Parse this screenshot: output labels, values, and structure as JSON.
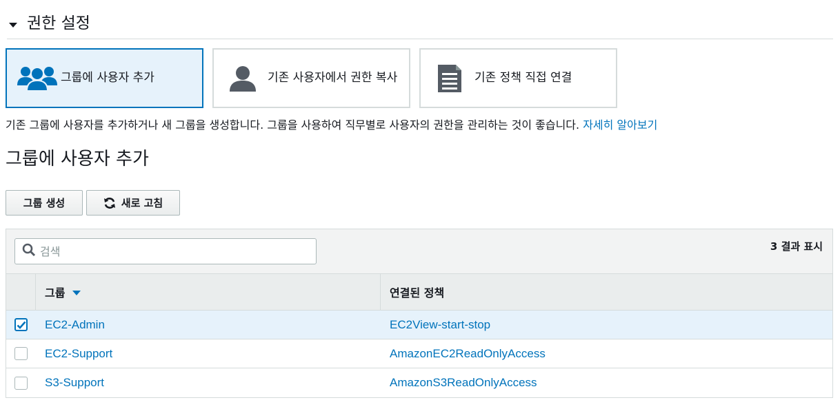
{
  "section": {
    "title": "권한 설정"
  },
  "options": [
    {
      "label": "그룹에 사용자 추가",
      "selected": true,
      "icon": "users-group-icon"
    },
    {
      "label": "기존 사용자에서 권한 복사",
      "selected": false,
      "icon": "user-icon"
    },
    {
      "label": "기존 정책 직접 연결",
      "selected": false,
      "icon": "document-icon"
    }
  ],
  "description": {
    "text": "기존 그룹에 사용자를 추가하거나 새 그룹을 생성합니다. 그룹을 사용하여 직무별로 사용자의 권한을 관리하는 것이 좋습니다. ",
    "link": "자세히 알아보기"
  },
  "subsection": {
    "title": "그룹에 사용자 추가"
  },
  "toolbar": {
    "create_label": "그룹 생성",
    "refresh_label": "새로 고침"
  },
  "table": {
    "search_placeholder": "검색",
    "result_count": "3 결과 표시",
    "columns": {
      "group": "그룹",
      "policy": "연결된 정책"
    },
    "rows": [
      {
        "group": "EC2-Admin",
        "policy": "EC2View-start-stop",
        "checked": true
      },
      {
        "group": "EC2-Support",
        "policy": "AmazonEC2ReadOnlyAccess",
        "checked": false
      },
      {
        "group": "S3-Support",
        "policy": "AmazonS3ReadOnlyAccess",
        "checked": false
      }
    ]
  },
  "colors": {
    "accent": "#0073bb",
    "selected_bg": "#e6f2fb",
    "icon_gray": "#545b64"
  }
}
